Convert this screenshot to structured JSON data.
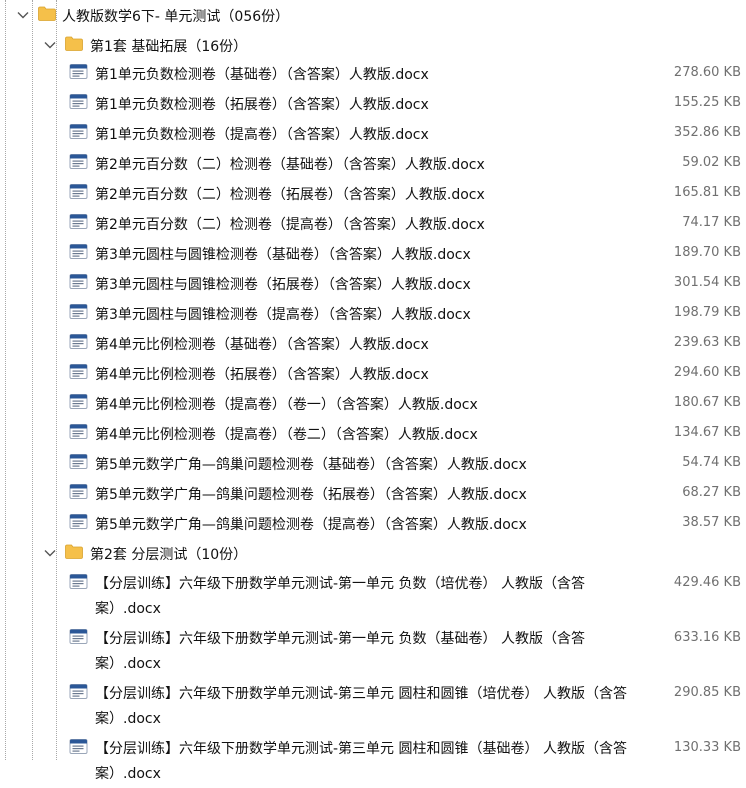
{
  "root": {
    "title": "人教版数学6下- 单元测试（056份）",
    "expanded": true
  },
  "groups": [
    {
      "title": "第1套 基础拓展（16份）",
      "expanded": true,
      "files": [
        {
          "name": "第1单元负数检测卷（基础卷）（含答案）人教版.docx",
          "size": "278.60 KB"
        },
        {
          "name": "第1单元负数检测卷（拓展卷）（含答案）人教版.docx",
          "size": "155.25 KB"
        },
        {
          "name": "第1单元负数检测卷（提高卷）（含答案）人教版.docx",
          "size": "352.86 KB"
        },
        {
          "name": "第2单元百分数（二）检测卷（基础卷）（含答案）人教版.docx",
          "size": "59.02 KB"
        },
        {
          "name": "第2单元百分数（二）检测卷（拓展卷）（含答案）人教版.docx",
          "size": "165.81 KB"
        },
        {
          "name": "第2单元百分数（二）检测卷（提高卷）（含答案）人教版.docx",
          "size": "74.17 KB"
        },
        {
          "name": "第3单元圆柱与圆锥检测卷（基础卷）（含答案）人教版.docx",
          "size": "189.70 KB"
        },
        {
          "name": "第3单元圆柱与圆锥检测卷（拓展卷）（含答案）人教版.docx",
          "size": "301.54 KB"
        },
        {
          "name": "第3单元圆柱与圆锥检测卷（提高卷）（含答案）人教版.docx",
          "size": "198.79 KB"
        },
        {
          "name": "第4单元比例检测卷（基础卷）（含答案）人教版.docx",
          "size": "239.63 KB"
        },
        {
          "name": "第4单元比例检测卷（拓展卷）（含答案）人教版.docx",
          "size": "294.60 KB"
        },
        {
          "name": "第4单元比例检测卷（提高卷）（卷一）（含答案）人教版.docx",
          "size": "180.67 KB"
        },
        {
          "name": "第4单元比例检测卷（提高卷）（卷二）（含答案）人教版.docx",
          "size": "134.67 KB"
        },
        {
          "name": "第5单元数学广角—鸽巢问题检测卷（基础卷）（含答案）人教版.docx",
          "size": "54.74 KB"
        },
        {
          "name": "第5单元数学广角—鸽巢问题检测卷（拓展卷）（含答案）人教版.docx",
          "size": "68.27 KB"
        },
        {
          "name": "第5单元数学广角—鸽巢问题检测卷（提高卷）（含答案）人教版.docx",
          "size": "38.57 KB"
        }
      ]
    },
    {
      "title": "第2套 分层测试（10份）",
      "expanded": true,
      "files": [
        {
          "name": "【分层训练】六年级下册数学单元测试-第一单元 负数（培优卷） 人教版（含答案）.docx",
          "size": "429.46 KB"
        },
        {
          "name": "【分层训练】六年级下册数学单元测试-第一单元 负数（基础卷） 人教版（含答案）.docx",
          "size": "633.16 KB"
        },
        {
          "name": "【分层训练】六年级下册数学单元测试-第三单元 圆柱和圆锥（培优卷） 人教版（含答案）.docx",
          "size": "290.85 KB"
        },
        {
          "name": "【分层训练】六年级下册数学单元测试-第三单元 圆柱和圆锥（基础卷） 人教版（含答案）.docx",
          "size": "130.33 KB"
        }
      ]
    }
  ],
  "icons": {
    "chevron": "chevron-down-icon",
    "folder": "folder-icon",
    "file": "word-document-icon"
  },
  "colors": {
    "folder": "#F5C04A",
    "doc_accent": "#2B5797",
    "size_text": "#707070",
    "tree_line": "#A8A8A8"
  }
}
